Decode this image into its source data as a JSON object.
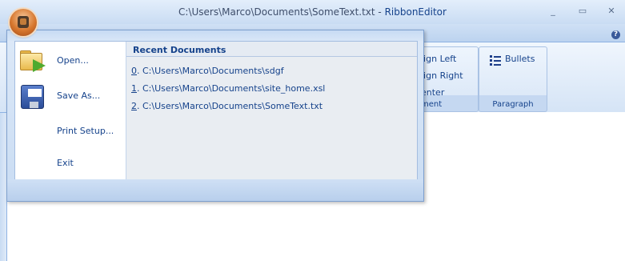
{
  "window": {
    "title_path": "C:\\Users\\Marco\\Documents\\SomeText.txt",
    "title_separator": " - ",
    "app_name": "RibbonEditor",
    "minimize_glyph": "_",
    "maximize_glyph": "▭",
    "close_glyph": "✕"
  },
  "ribbon": {
    "help_glyph": "?",
    "alignment_group": {
      "items": [
        "lign Left",
        "lign Right",
        "enter"
      ],
      "label": "ment"
    },
    "paragraph_group": {
      "bullets_label": "Bullets",
      "label": "Paragraph"
    }
  },
  "app_menu": {
    "items": [
      {
        "label": "Open...",
        "icon": "open-folder-icon"
      },
      {
        "label": "Save As...",
        "icon": "floppy-disk-icon"
      },
      {
        "label": "Print Setup..."
      },
      {
        "label": "Exit"
      }
    ],
    "recent": {
      "title": "Recent Documents",
      "items": [
        {
          "num": "0",
          "path": ". C:\\Users\\Marco\\Documents\\sdgf"
        },
        {
          "num": "1",
          "path": ". C:\\Users\\Marco\\Documents\\site_home.xsl"
        },
        {
          "num": "2",
          "path": ". C:\\Users\\Marco\\Documents\\SomeText.txt"
        }
      ]
    }
  }
}
